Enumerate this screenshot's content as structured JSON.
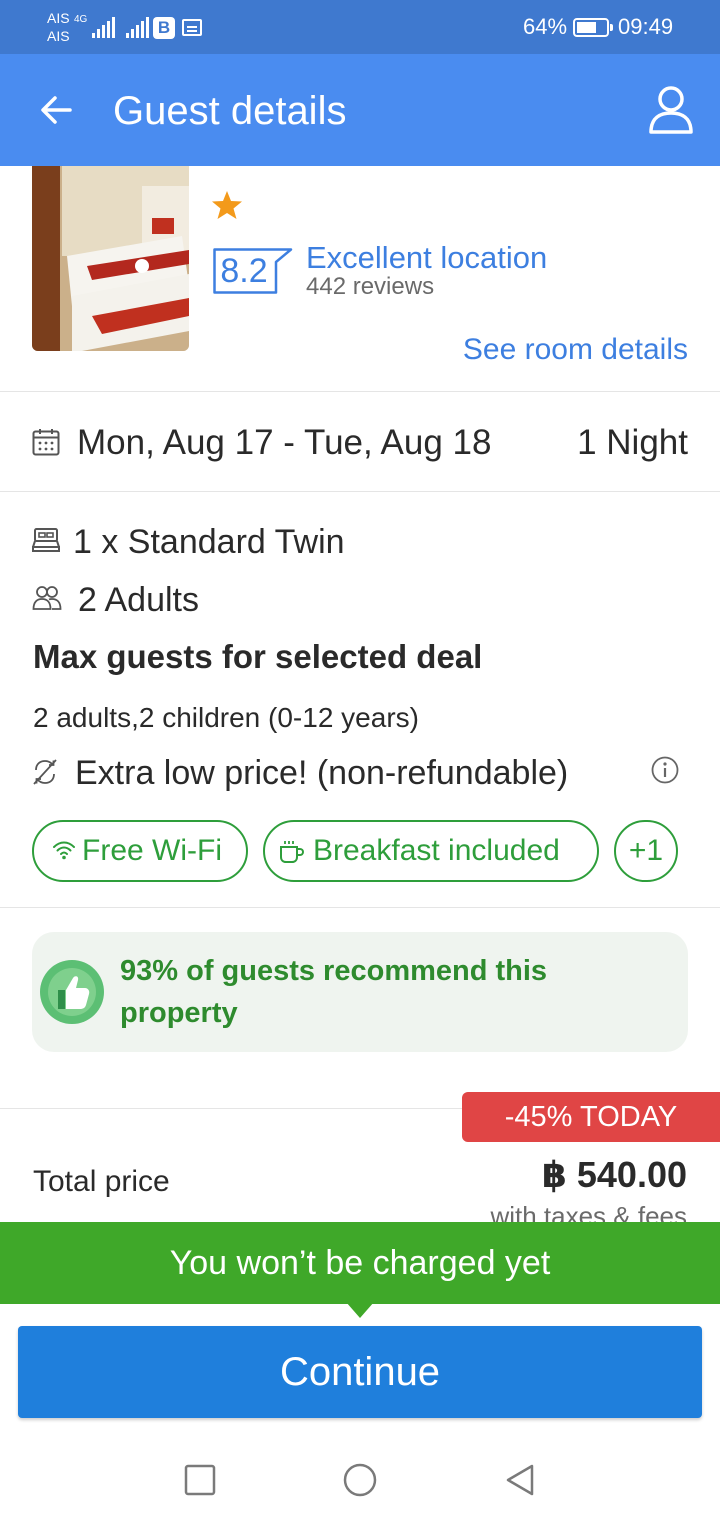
{
  "status_bar": {
    "carrier_1": "AIS",
    "carrier_2": "AIS",
    "network": "4G",
    "battery": "64%",
    "time": "09:49",
    "icons": [
      "signal-icon",
      "signal-icon",
      "b-app-icon",
      "calendar-icon",
      "battery-icon"
    ]
  },
  "app_bar": {
    "title": "Guest details",
    "back_icon": "arrow-left-icon",
    "profile_icon": "person-icon"
  },
  "hotel": {
    "stars": 1,
    "score": "8.2",
    "rating_label": "Excellent location",
    "reviews": "442 reviews",
    "room_details_link": "See room details"
  },
  "stay": {
    "dates": "Mon, Aug 17 - Tue, Aug 18",
    "nights": "1 Night"
  },
  "room": {
    "type": "1 x Standard Twin",
    "guests": "2 Adults",
    "max_title": "Max guests for selected deal",
    "max_detail": "2 adults,2 children (0-12 years)",
    "price_note": "Extra low price! (non-refundable)"
  },
  "amenities": [
    "Free Wi-Fi",
    "Breakfast included",
    "+1"
  ],
  "recommend": {
    "text": "93% of guests recommend this property"
  },
  "price": {
    "discount": "-45% TODAY",
    "total_label": "Total price",
    "total": "฿ 540.00",
    "tax_note": "with taxes & fees"
  },
  "footer": {
    "charge_note": "You won’t be charged yet",
    "continue_label": "Continue"
  },
  "colors": {
    "status_bar": "#3f79cf",
    "app_bar": "#4a8cf0",
    "link_blue": "#3d7fe0",
    "green": "#2e9e3b",
    "banner_green": "#3fa829",
    "discount_red": "#e04545",
    "button_blue": "#1f7fdc"
  }
}
